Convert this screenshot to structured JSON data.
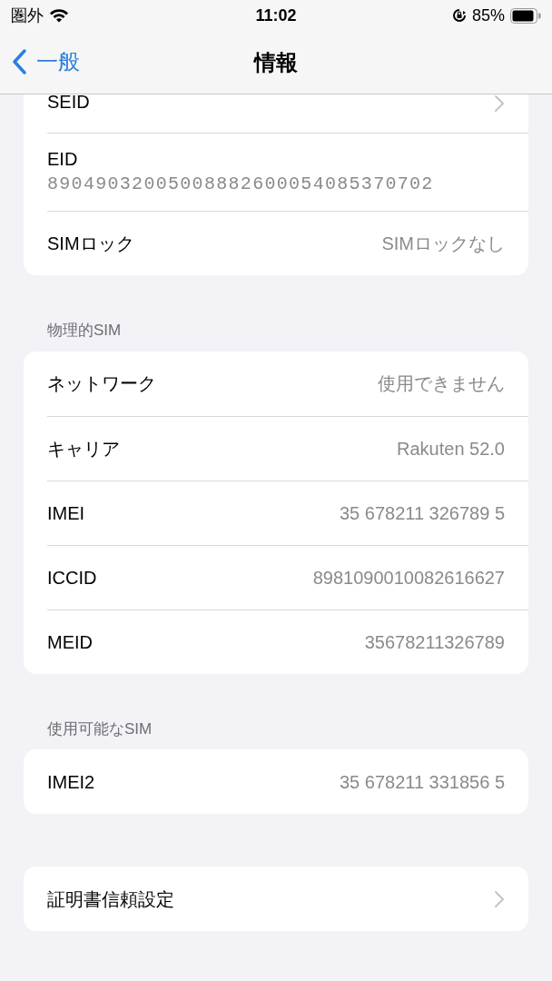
{
  "status_bar": {
    "carrier": "圏外",
    "time": "11:02",
    "battery": "85%"
  },
  "nav": {
    "back": "一般",
    "title": "情報"
  },
  "groups": [
    {
      "cut_top": true,
      "rows": [
        {
          "kind": "link",
          "label": "SEID"
        },
        {
          "kind": "subtitle",
          "label": "EID",
          "value": "89049032005008882600054085370702"
        },
        {
          "kind": "value",
          "label": "SIMロック",
          "value": "SIMロックなし"
        }
      ]
    },
    {
      "header": "物理的SIM",
      "rows": [
        {
          "kind": "value",
          "label": "ネットワーク",
          "value": "使用できません"
        },
        {
          "kind": "value",
          "label": "キャリア",
          "value": "Rakuten 52.0"
        },
        {
          "kind": "value",
          "label": "IMEI",
          "value": "35 678211 326789 5"
        },
        {
          "kind": "value",
          "label": "ICCID",
          "value": "8981090010082616627"
        },
        {
          "kind": "value",
          "label": "MEID",
          "value": "35678211326789"
        }
      ]
    },
    {
      "header": "使用可能なSIM",
      "rows": [
        {
          "kind": "value",
          "label": "IMEI2",
          "value": "35 678211 331856 5"
        }
      ]
    },
    {
      "rows": [
        {
          "kind": "link",
          "label": "証明書信頼設定"
        }
      ]
    }
  ]
}
